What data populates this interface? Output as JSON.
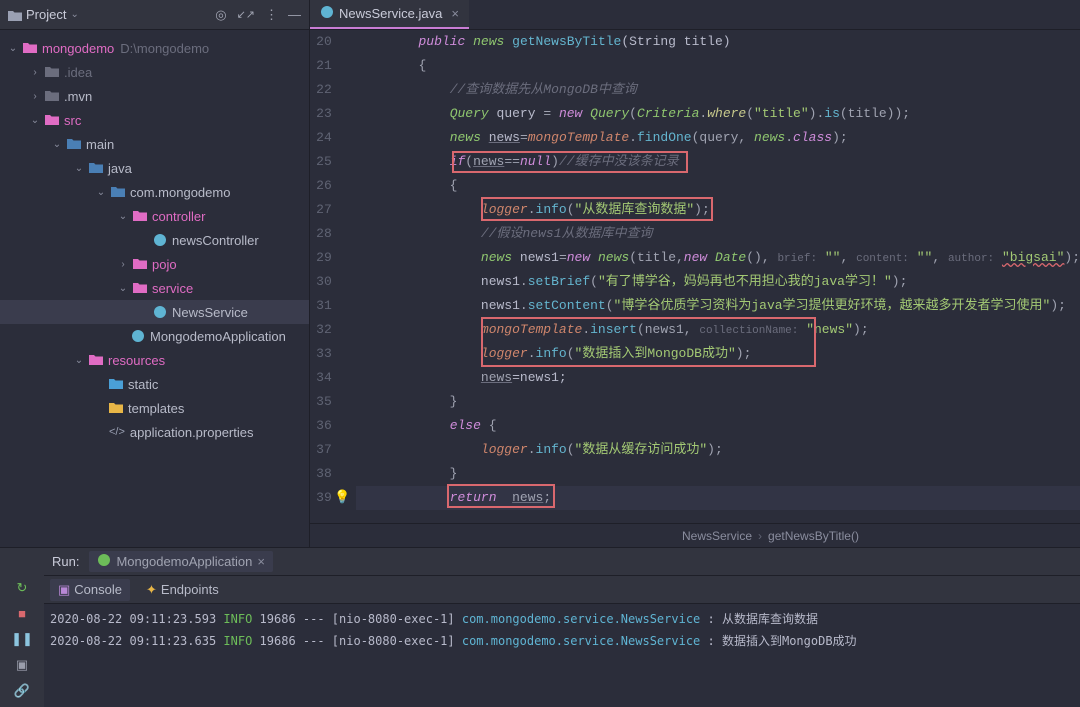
{
  "project_panel": {
    "title": "Project",
    "root": {
      "name": "mongodemo",
      "path": "D:\\mongodemo"
    },
    "idea": ".idea",
    "mvn": ".mvn",
    "src": "src",
    "main": "main",
    "java": "java",
    "package": "com.mongodemo",
    "controller": "controller",
    "newsController": "newsController",
    "pojo": "pojo",
    "service": "service",
    "news_service": "NewsService",
    "app_class": "MongodemoApplication",
    "resources": "resources",
    "static": "static",
    "templates": "templates",
    "app_props": "application.properties"
  },
  "tabs": {
    "file": "NewsService.java"
  },
  "gutter_start": 20,
  "breadcrumb": {
    "a": "NewsService",
    "b": "getNewsByTitle()"
  },
  "code": {
    "l20_pre": "        ",
    "l20_public": "public",
    "l20_news": "news",
    "l20_method": "getNewsByTitle",
    "l20_sig1": "(String title)",
    "l22_comment": "//查询数据先从MongoDB中查询",
    "l23_query": "Query",
    "l23_q2": "query = ",
    "l23_new": "new",
    "l23_crit": "Criteria",
    "l23_where": "where",
    "l23_title": "\"title\"",
    "l23_is": "is",
    "l23_p": "(title));",
    "l24_news": "news",
    "l24_mid": "=mongoTemplate.",
    "l24_find": "findOne",
    "l24_args": "(query, news.",
    "l24_class": "class",
    "l25_if": "if",
    "l25_null": "null",
    "l25_comment": "//缓存中没该条记录",
    "l27_logger": "logger",
    "l27_info": "info",
    "l27_msg": "\"从数据库查询数据\"",
    "l28_comment": "//假设news1从数据库中查询",
    "l29_news": "news",
    "l29_news1": "news1=",
    "l29_new": "new",
    "l29_ctor": "news",
    "l29_title": "(title,",
    "l29_date": "Date",
    "l29_brief": "brief:",
    "l29_content": "content:",
    "l29_author": "author:",
    "l29_bigsai": "\"bigsai\"",
    "l30_news1": "news1.",
    "l30_setBrief": "setBrief",
    "l30_msg": "\"有了博学谷，妈妈再也不用担心我的java学习！\"",
    "l31_setContent": "setContent",
    "l31_msg": "\"博学谷优质学习资料为java学习提供更好环境，越来越多开发者学习使用\"",
    "l32_mongo": "mongoTemplate.",
    "l32_insert": "insert",
    "l32_args": "(news1, ",
    "l32_coll": "collectionName:",
    "l32_newsstr": "\"news\"",
    "l33_msg": "\"数据插入到MongoDB成功\"",
    "l34_news": "news",
    "l34_end": "=news1;",
    "l36_else": "else",
    "l37_msg": "\"数据从缓存访问成功\"",
    "l39_return": "return"
  },
  "run": {
    "label": "Run:",
    "config": "MongodemoApplication",
    "console_tab": "Console",
    "endpoints_tab": "Endpoints",
    "lines": [
      {
        "ts": "2020-08-22  09:11:23.593",
        "level": "INFO",
        "pid": "19686",
        "thread": "[nio-8080-exec-1]",
        "logger": "com.mongodemo.service.NewsService",
        "msg": "从数据库查询数据"
      },
      {
        "ts": "2020-08-22  09:11:23.635",
        "level": "INFO",
        "pid": "19686",
        "thread": "[nio-8080-exec-1]",
        "logger": "com.mongodemo.service.NewsService",
        "msg": "数据插入到MongoDB成功"
      }
    ]
  }
}
